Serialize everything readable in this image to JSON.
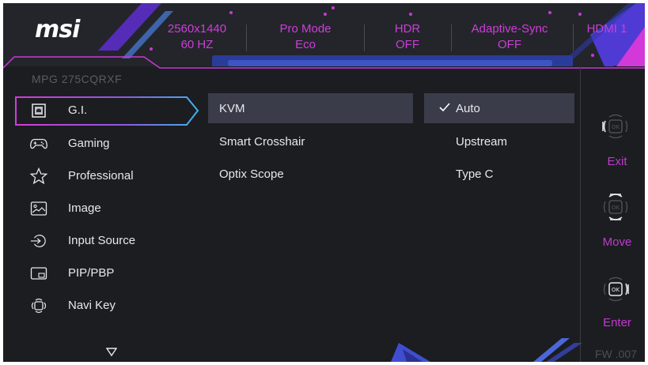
{
  "header": {
    "logo": "msi",
    "resolution_line1": "2560x1440",
    "resolution_line2": "60 HZ",
    "mode_line1": "Pro Mode",
    "mode_line2": "Eco",
    "hdr_line1": "HDR",
    "hdr_line2": "OFF",
    "sync_line1": "Adaptive-Sync",
    "sync_line2": "OFF",
    "input": "HDMI 1"
  },
  "model": "MPG 275CQRXF",
  "menu": {
    "items": [
      {
        "label": "G.I.",
        "icon": "gi-icon",
        "selected": true
      },
      {
        "label": "Gaming",
        "icon": "gamepad-icon"
      },
      {
        "label": "Professional",
        "icon": "star-icon"
      },
      {
        "label": "Image",
        "icon": "image-icon"
      },
      {
        "label": "Input Source",
        "icon": "input-source-icon"
      },
      {
        "label": "PIP/PBP",
        "icon": "pip-icon"
      },
      {
        "label": "Navi Key",
        "icon": "navi-key-icon"
      }
    ],
    "more_icon": "down-triangle-icon"
  },
  "submenu": {
    "items": [
      {
        "label": "KVM",
        "selected": true
      },
      {
        "label": "Smart Crosshair"
      },
      {
        "label": "Optix Scope"
      }
    ]
  },
  "options": {
    "items": [
      {
        "label": "Auto",
        "checked": true
      },
      {
        "label": "Upstream"
      },
      {
        "label": "Type C"
      }
    ]
  },
  "keys": {
    "exit": "Exit",
    "move": "Move",
    "enter": "Enter"
  },
  "firmware": "FW .007",
  "colors": {
    "accent_magenta": "#cc3ed8",
    "accent_blue": "#3d55c4",
    "background": "#1c1d21",
    "selection": "#3a3c4a"
  }
}
